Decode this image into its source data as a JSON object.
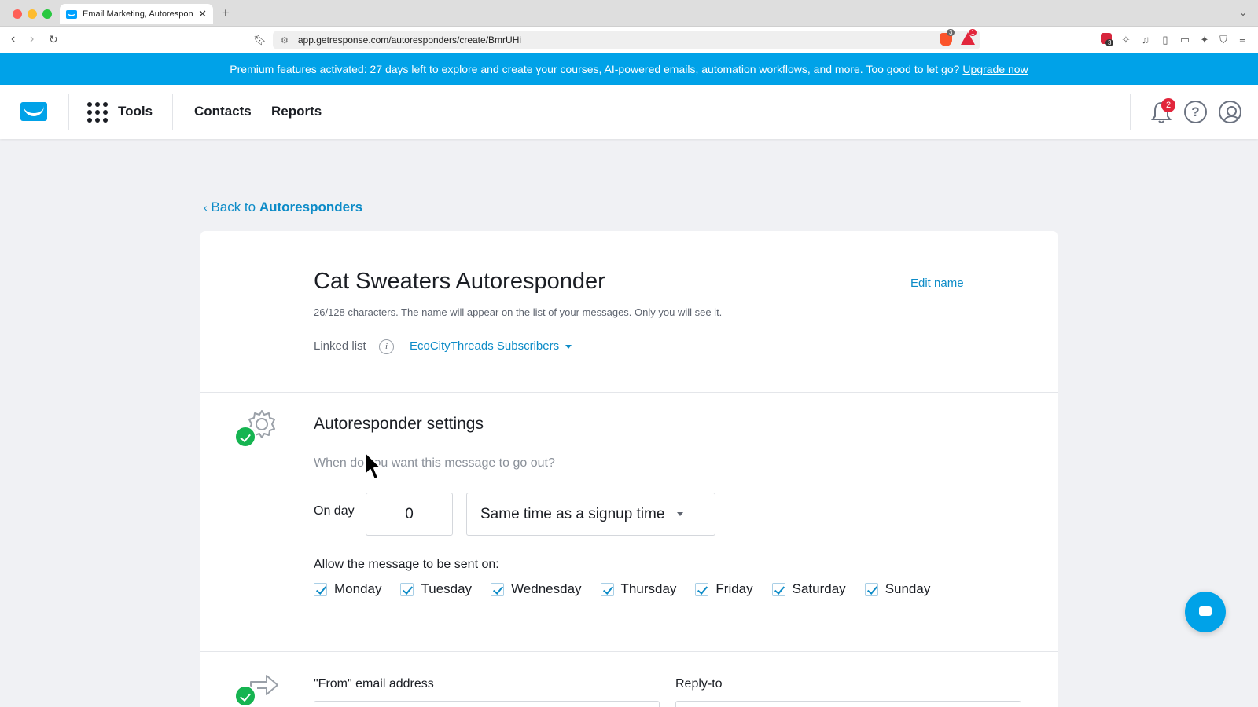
{
  "browser": {
    "tab_title": "Email Marketing, Autorespon",
    "url": "app.getresponse.com/autoresponders/create/BmrUHi",
    "brave_badge": "3",
    "alert_badge": "1",
    "ext_badge": "3"
  },
  "banner": {
    "text": "Premium features activated: 27 days left to explore and create your courses, AI-powered emails, automation workflows, and more. Too good to let go?",
    "link": "Upgrade now"
  },
  "header": {
    "tools": "Tools",
    "contacts": "Contacts",
    "reports": "Reports",
    "notification_count": "2",
    "help": "?"
  },
  "back": {
    "prefix": "Back to",
    "target": "Autoresponders"
  },
  "autoresponder": {
    "title": "Cat Sweaters Autoresponder",
    "edit_name": "Edit name",
    "char_hint": "26/128 characters. The name will appear on the list of your messages. Only you will see it.",
    "linked_list_label": "Linked list",
    "info": "i",
    "linked_list_value": "EcoCityThreads Subscribers"
  },
  "settings": {
    "title": "Autoresponder settings",
    "subtitle": "When do you want this message to go out?",
    "on_day_label": "On day",
    "on_day_value": "0",
    "time_option": "Same time as a signup time",
    "allow_label": "Allow the message to be sent on:",
    "days": [
      "Monday",
      "Tuesday",
      "Wednesday",
      "Thursday",
      "Friday",
      "Saturday",
      "Sunday"
    ]
  },
  "sender": {
    "from_label": "\"From\" email address",
    "reply_label": "Reply-to"
  },
  "colors": {
    "accent": "#00a2e8",
    "link": "#0c8bc7",
    "success": "#16b451",
    "badge": "#e2263c"
  }
}
